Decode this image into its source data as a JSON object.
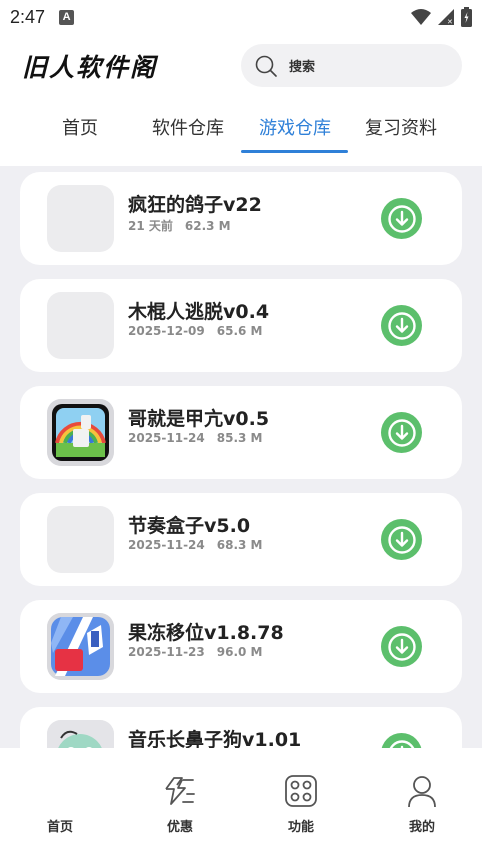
{
  "status_bar": {
    "time": "2:47",
    "notification_icon": "A",
    "icons": [
      "wifi-icon",
      "signal-icon",
      "battery-icon"
    ]
  },
  "header": {
    "app_title": "旧人软件阁",
    "search_placeholder": "搜索"
  },
  "tabs": [
    {
      "label": "首页",
      "active": false
    },
    {
      "label": "软件仓库",
      "active": false
    },
    {
      "label": "游戏仓库",
      "active": true
    },
    {
      "label": "复习资料",
      "active": false
    }
  ],
  "apps": [
    {
      "name": "疯狂的鸽子v22",
      "date": "21 天前",
      "size": "62.3 M",
      "icon": "blank"
    },
    {
      "name": "木棍人逃脱v0.4",
      "date": "2025-12-09",
      "size": "65.6 M",
      "icon": "blank"
    },
    {
      "name": "哥就是甲亢v0.5",
      "date": "2025-11-24",
      "size": "85.3 M",
      "icon": "rainbow-game-icon"
    },
    {
      "name": "节奏盒子v5.0",
      "date": "2025-11-24",
      "size": "68.3 M",
      "icon": "blank"
    },
    {
      "name": "果冻移位v1.8.78",
      "date": "2025-11-23",
      "size": "96.0 M",
      "icon": "jelly-game-icon"
    },
    {
      "name": "音乐长鼻子狗v1.01",
      "date": "",
      "size": "",
      "icon": "dog-game-icon"
    }
  ],
  "bottom_nav": [
    {
      "label": "首页",
      "icon": "home-icon"
    },
    {
      "label": "优惠",
      "icon": "lightning-icon"
    },
    {
      "label": "功能",
      "icon": "grid-icon"
    },
    {
      "label": "我的",
      "icon": "user-icon"
    }
  ],
  "colors": {
    "accent": "#2f80d8",
    "download": "#5cbf6c",
    "background": "#efeff3"
  }
}
